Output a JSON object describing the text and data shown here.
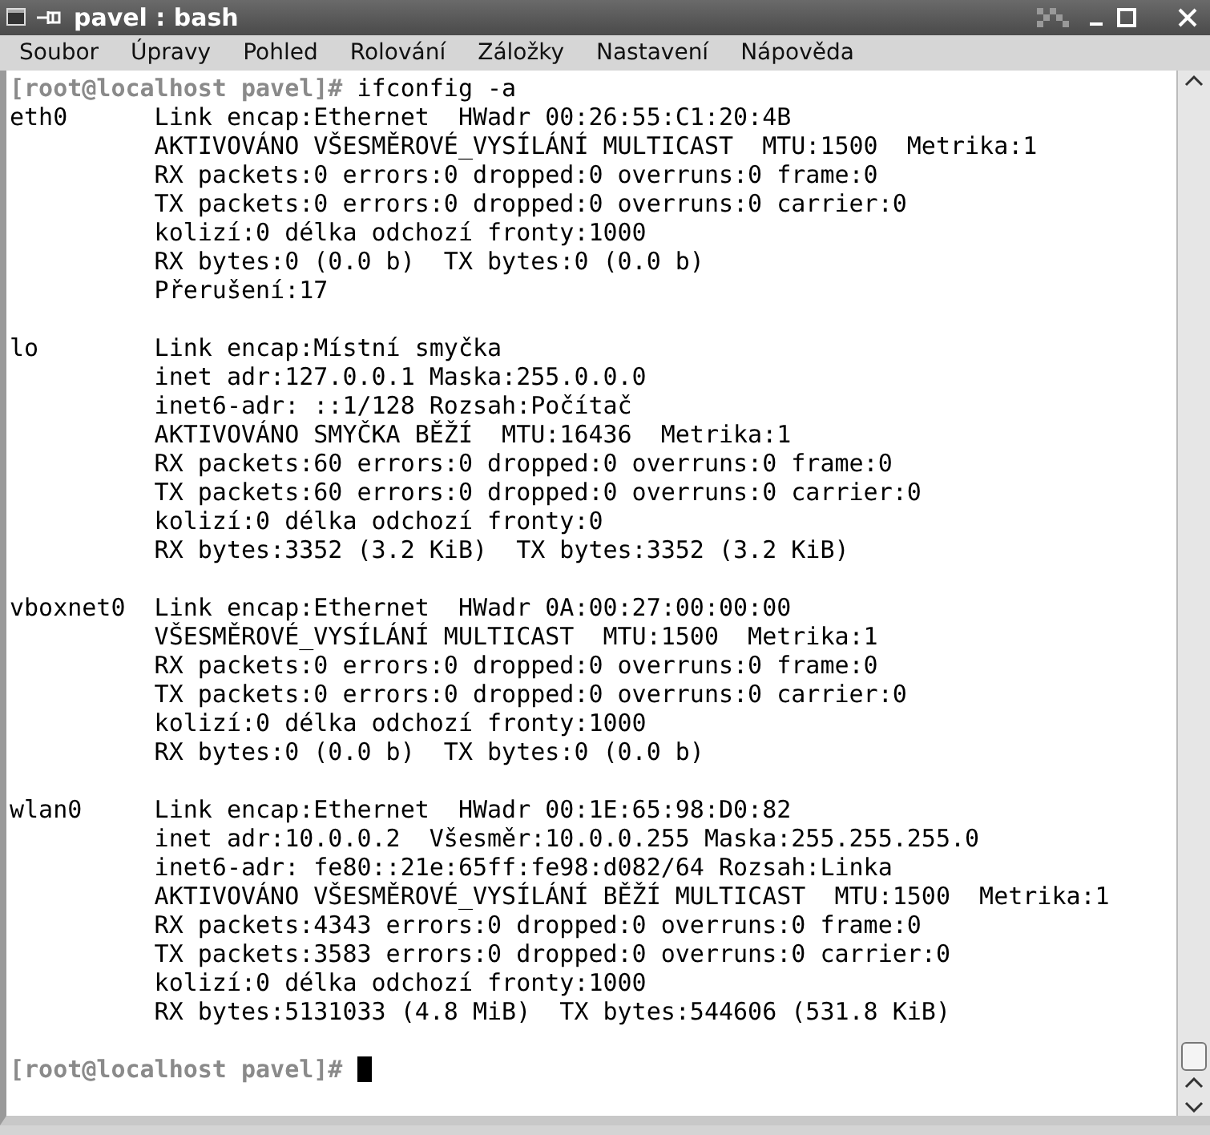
{
  "window": {
    "title": "pavel : bash"
  },
  "menu": [
    "Soubor",
    "Úpravy",
    "Pohled",
    "Rolování",
    "Záložky",
    "Nastavení",
    "Nápověda"
  ],
  "terminal": {
    "lines": [
      {
        "kind": "prompt",
        "prompt": "[root@localhost pavel]#",
        "command": "ifconfig -a",
        "cursor": false
      },
      {
        "kind": "output",
        "label": "eth0",
        "text": "Link encap:Ethernet  HWadr 00:26:55:C1:20:4B"
      },
      {
        "kind": "output",
        "text": "AKTIVOVÁNO VŠESMĚROVÉ_VYSÍLÁNÍ MULTICAST  MTU:1500  Metrika:1"
      },
      {
        "kind": "output",
        "text": "RX packets:0 errors:0 dropped:0 overruns:0 frame:0"
      },
      {
        "kind": "output",
        "text": "TX packets:0 errors:0 dropped:0 overruns:0 carrier:0"
      },
      {
        "kind": "output",
        "text": "kolizí:0 délka odchozí fronty:1000"
      },
      {
        "kind": "output",
        "text": "RX bytes:0 (0.0 b)  TX bytes:0 (0.0 b)"
      },
      {
        "kind": "output",
        "text": "Přerušení:17"
      },
      {
        "kind": "blank"
      },
      {
        "kind": "output",
        "label": "lo",
        "text": "Link encap:Místní smyčka"
      },
      {
        "kind": "output",
        "text": "inet adr:127.0.0.1 Maska:255.0.0.0"
      },
      {
        "kind": "output",
        "text": "inet6-adr: ::1/128 Rozsah:Počítač"
      },
      {
        "kind": "output",
        "text": "AKTIVOVÁNO SMYČKA BĚŽÍ  MTU:16436  Metrika:1"
      },
      {
        "kind": "output",
        "text": "RX packets:60 errors:0 dropped:0 overruns:0 frame:0"
      },
      {
        "kind": "output",
        "text": "TX packets:60 errors:0 dropped:0 overruns:0 carrier:0"
      },
      {
        "kind": "output",
        "text": "kolizí:0 délka odchozí fronty:0"
      },
      {
        "kind": "output",
        "text": "RX bytes:3352 (3.2 KiB)  TX bytes:3352 (3.2 KiB)"
      },
      {
        "kind": "blank"
      },
      {
        "kind": "output",
        "label": "vboxnet0",
        "text": "Link encap:Ethernet  HWadr 0A:00:27:00:00:00"
      },
      {
        "kind": "output",
        "text": "VŠESMĚROVÉ_VYSÍLÁNÍ MULTICAST  MTU:1500  Metrika:1"
      },
      {
        "kind": "output",
        "text": "RX packets:0 errors:0 dropped:0 overruns:0 frame:0"
      },
      {
        "kind": "output",
        "text": "TX packets:0 errors:0 dropped:0 overruns:0 carrier:0"
      },
      {
        "kind": "output",
        "text": "kolizí:0 délka odchozí fronty:1000"
      },
      {
        "kind": "output",
        "text": "RX bytes:0 (0.0 b)  TX bytes:0 (0.0 b)"
      },
      {
        "kind": "blank"
      },
      {
        "kind": "output",
        "label": "wlan0",
        "text": "Link encap:Ethernet  HWadr 00:1E:65:98:D0:82"
      },
      {
        "kind": "output",
        "text": "inet adr:10.0.0.2  Všesměr:10.0.0.255 Maska:255.255.255.0"
      },
      {
        "kind": "output",
        "text": "inet6-adr: fe80::21e:65ff:fe98:d082/64 Rozsah:Linka"
      },
      {
        "kind": "output",
        "text": "AKTIVOVÁNO VŠESMĚROVÉ_VYSÍLÁNÍ BĚŽÍ MULTICAST  MTU:1500  Metrika:1"
      },
      {
        "kind": "output",
        "text": "RX packets:4343 errors:0 dropped:0 overruns:0 frame:0"
      },
      {
        "kind": "output",
        "text": "TX packets:3583 errors:0 dropped:0 overruns:0 carrier:0"
      },
      {
        "kind": "output",
        "text": "kolizí:0 délka odchozí fronty:1000"
      },
      {
        "kind": "output",
        "text": "RX bytes:5131033 (4.8 MiB)  TX bytes:544606 (531.8 KiB)"
      },
      {
        "kind": "blank"
      },
      {
        "kind": "prompt",
        "prompt": "[root@localhost pavel]#",
        "cursor": true
      }
    ]
  }
}
